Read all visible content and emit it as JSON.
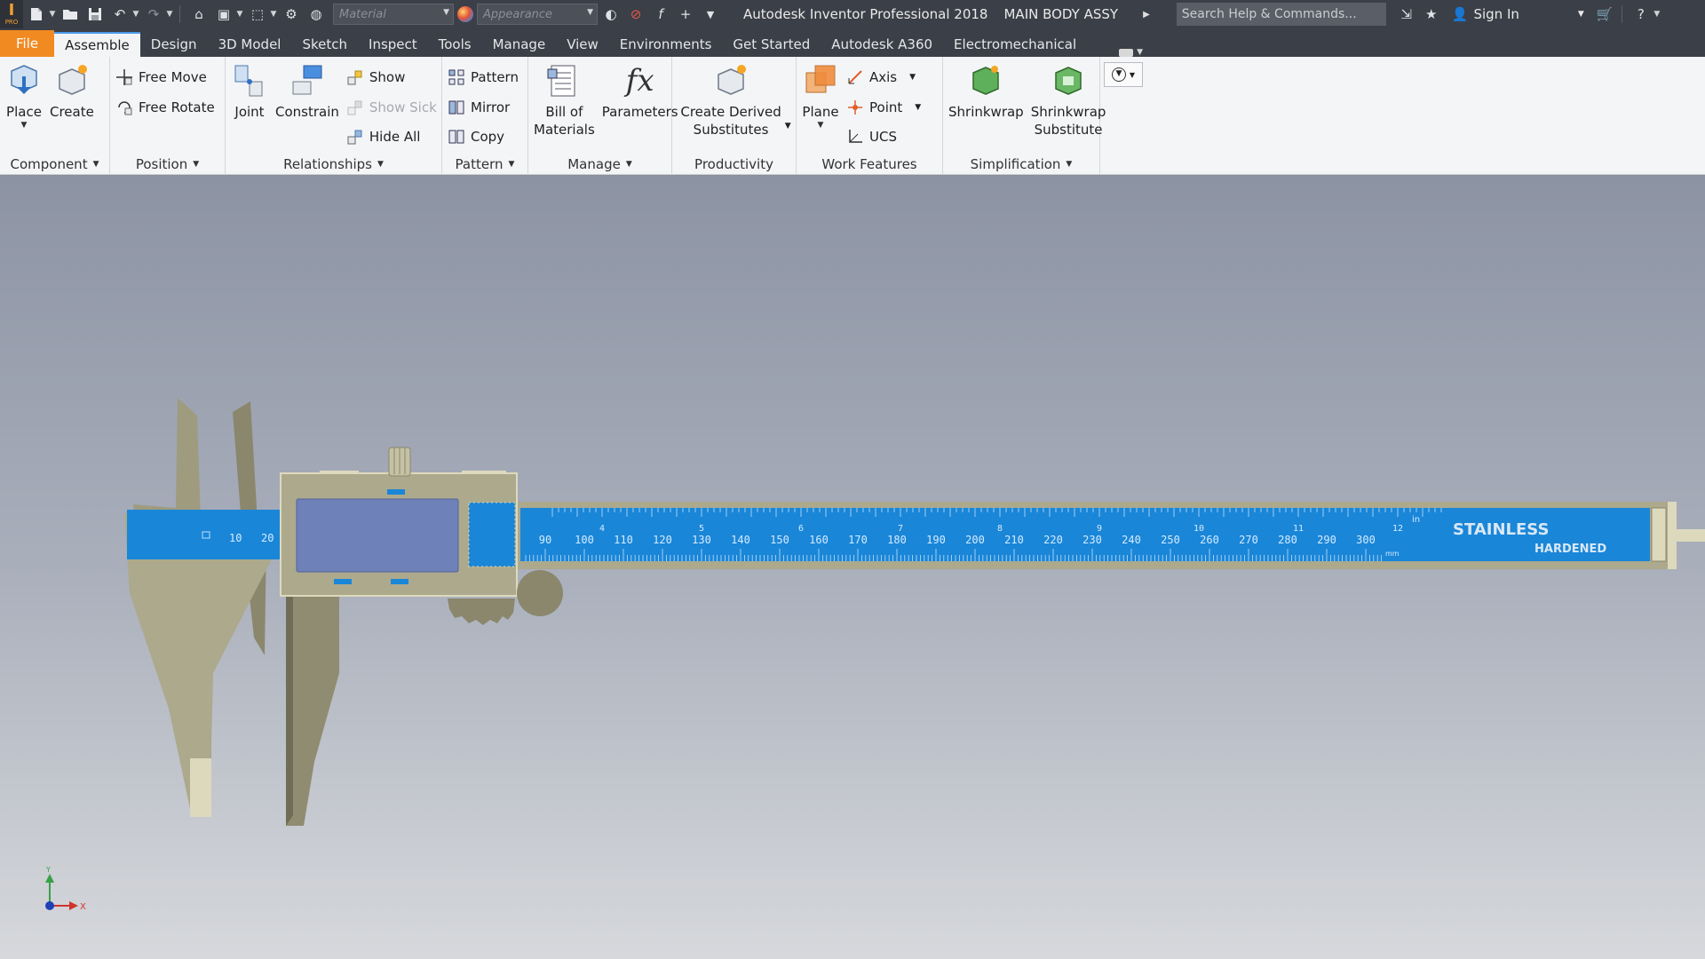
{
  "app": {
    "logo_letter": "I",
    "logo_sub": "PRO",
    "title": "Autodesk Inventor Professional 2018",
    "document": "MAIN BODY ASSY",
    "material_placeholder": "Material",
    "appearance_placeholder": "Appearance",
    "search_placeholder": "Search Help & Commands...",
    "sign_in": "Sign In"
  },
  "tabs": [
    {
      "label": "File"
    },
    {
      "label": "Assemble"
    },
    {
      "label": "Design"
    },
    {
      "label": "3D Model"
    },
    {
      "label": "Sketch"
    },
    {
      "label": "Inspect"
    },
    {
      "label": "Tools"
    },
    {
      "label": "Manage"
    },
    {
      "label": "View"
    },
    {
      "label": "Environments"
    },
    {
      "label": "Get Started"
    },
    {
      "label": "Autodesk A360"
    },
    {
      "label": "Electromechanical"
    }
  ],
  "ribbon": {
    "component": {
      "title": "Component",
      "place": "Place",
      "create": "Create"
    },
    "position": {
      "title": "Position",
      "free_move": "Free Move",
      "free_rotate": "Free Rotate"
    },
    "relationships": {
      "title": "Relationships",
      "joint": "Joint",
      "constrain": "Constrain",
      "show": "Show",
      "show_sick": "Show Sick",
      "hide_all": "Hide All"
    },
    "pattern": {
      "title": "Pattern",
      "pattern": "Pattern",
      "mirror": "Mirror",
      "copy": "Copy"
    },
    "manage": {
      "title": "Manage",
      "bom_line1": "Bill of",
      "bom_line2": "Materials",
      "parameters": "Parameters"
    },
    "productivity": {
      "title": "Productivity",
      "cds_line1": "Create Derived",
      "cds_line2": "Substitutes"
    },
    "work_features": {
      "title": "Work Features",
      "plane": "Plane",
      "axis": "Axis",
      "point": "Point",
      "ucs": "UCS"
    },
    "simplification": {
      "title": "Simplification",
      "shrinkwrap": "Shrinkwrap",
      "sws_line1": "Shrinkwrap",
      "sws_line2": "Substitute"
    }
  },
  "model": {
    "stainless": "STAINLESS",
    "hardened": "HARDENED",
    "unit_in": "in",
    "unit_mm": "mm",
    "mm_labels": [
      "90",
      "100",
      "110",
      "120",
      "130",
      "140",
      "150",
      "160",
      "170",
      "180",
      "190",
      "200",
      "210",
      "220",
      "230",
      "240",
      "250",
      "260",
      "270",
      "280",
      "290",
      "300"
    ],
    "in_labels": [
      "4",
      "5",
      "6",
      "7",
      "8",
      "9",
      "10",
      "11",
      "12"
    ],
    "left_labels": [
      "10",
      "20"
    ]
  },
  "triad": {
    "x": "X",
    "y": "Y"
  },
  "colors": {
    "file_tab": "#f28a22",
    "blade_blue": "#1a86d8",
    "body_khaki": "#aca98d",
    "dark_bar": "#3b3f47"
  }
}
